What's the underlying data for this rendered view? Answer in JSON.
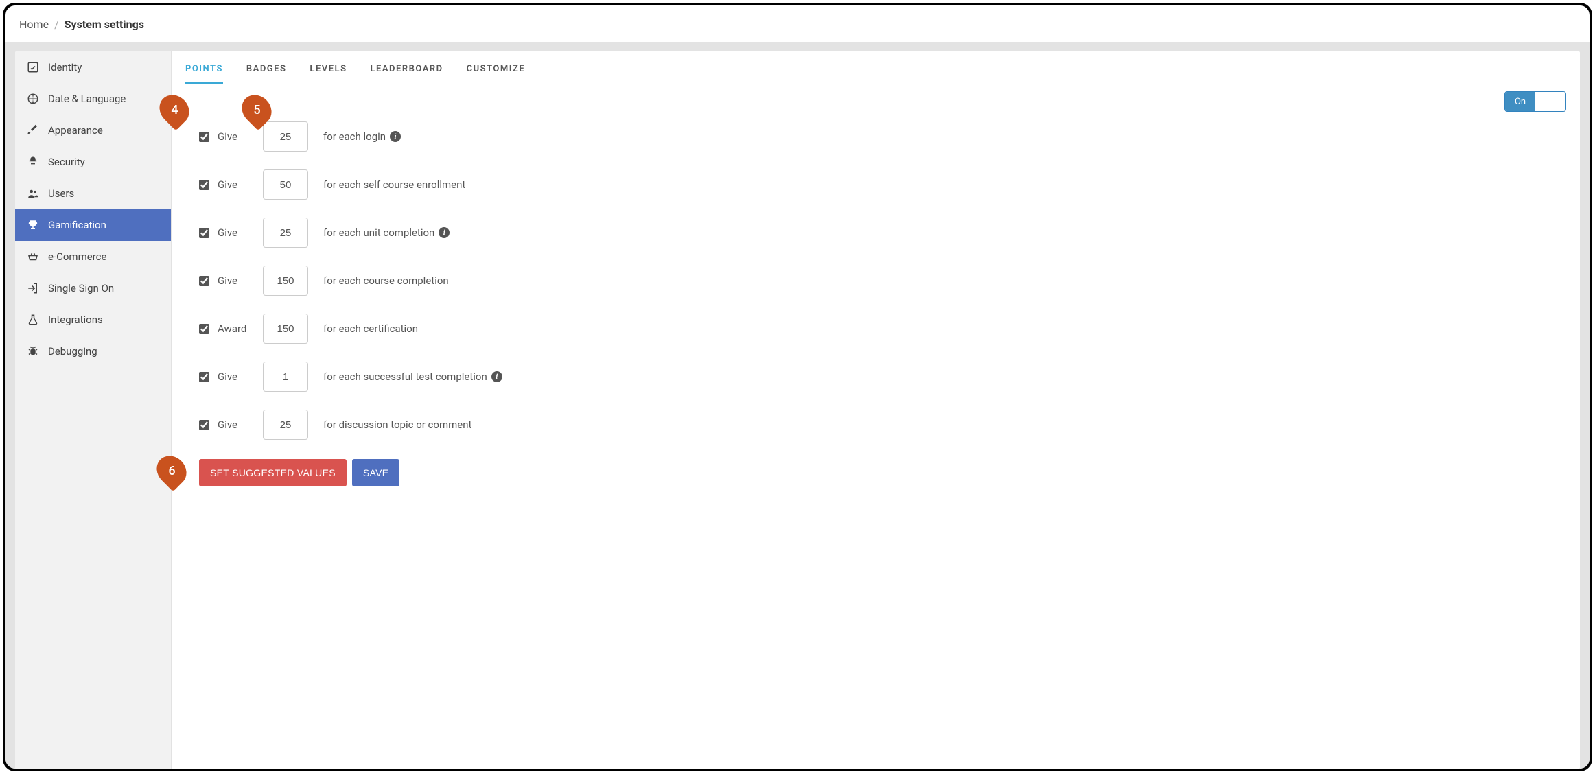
{
  "breadcrumb": {
    "home": "Home",
    "current": "System settings"
  },
  "sidebar": {
    "items": [
      {
        "label": "Identity"
      },
      {
        "label": "Date & Language"
      },
      {
        "label": "Appearance"
      },
      {
        "label": "Security"
      },
      {
        "label": "Users"
      },
      {
        "label": "Gamification"
      },
      {
        "label": "e-Commerce"
      },
      {
        "label": "Single Sign On"
      },
      {
        "label": "Integrations"
      },
      {
        "label": "Debugging"
      }
    ]
  },
  "tabs": {
    "items": [
      {
        "label": "POINTS"
      },
      {
        "label": "BADGES"
      },
      {
        "label": "LEVELS"
      },
      {
        "label": "LEADERBOARD"
      },
      {
        "label": "CUSTOMIZE"
      }
    ]
  },
  "toggle": {
    "on_label": "On"
  },
  "rows": [
    {
      "verb": "Give",
      "value": "25",
      "desc": "for each login",
      "info": true
    },
    {
      "verb": "Give",
      "value": "50",
      "desc": "for each self course enrollment",
      "info": false
    },
    {
      "verb": "Give",
      "value": "25",
      "desc": "for each unit completion",
      "info": true
    },
    {
      "verb": "Give",
      "value": "150",
      "desc": "for each course completion",
      "info": false
    },
    {
      "verb": "Award",
      "value": "150",
      "desc": "for each certification",
      "info": false
    },
    {
      "verb": "Give",
      "value": "1",
      "desc": "for each successful test completion",
      "info": true
    },
    {
      "verb": "Give",
      "value": "25",
      "desc": "for discussion topic or comment",
      "info": false
    }
  ],
  "buttons": {
    "suggested": "SET SUGGESTED VALUES",
    "save": "SAVE"
  },
  "annotations": {
    "a4": "4",
    "a5": "5",
    "a6": "6"
  }
}
